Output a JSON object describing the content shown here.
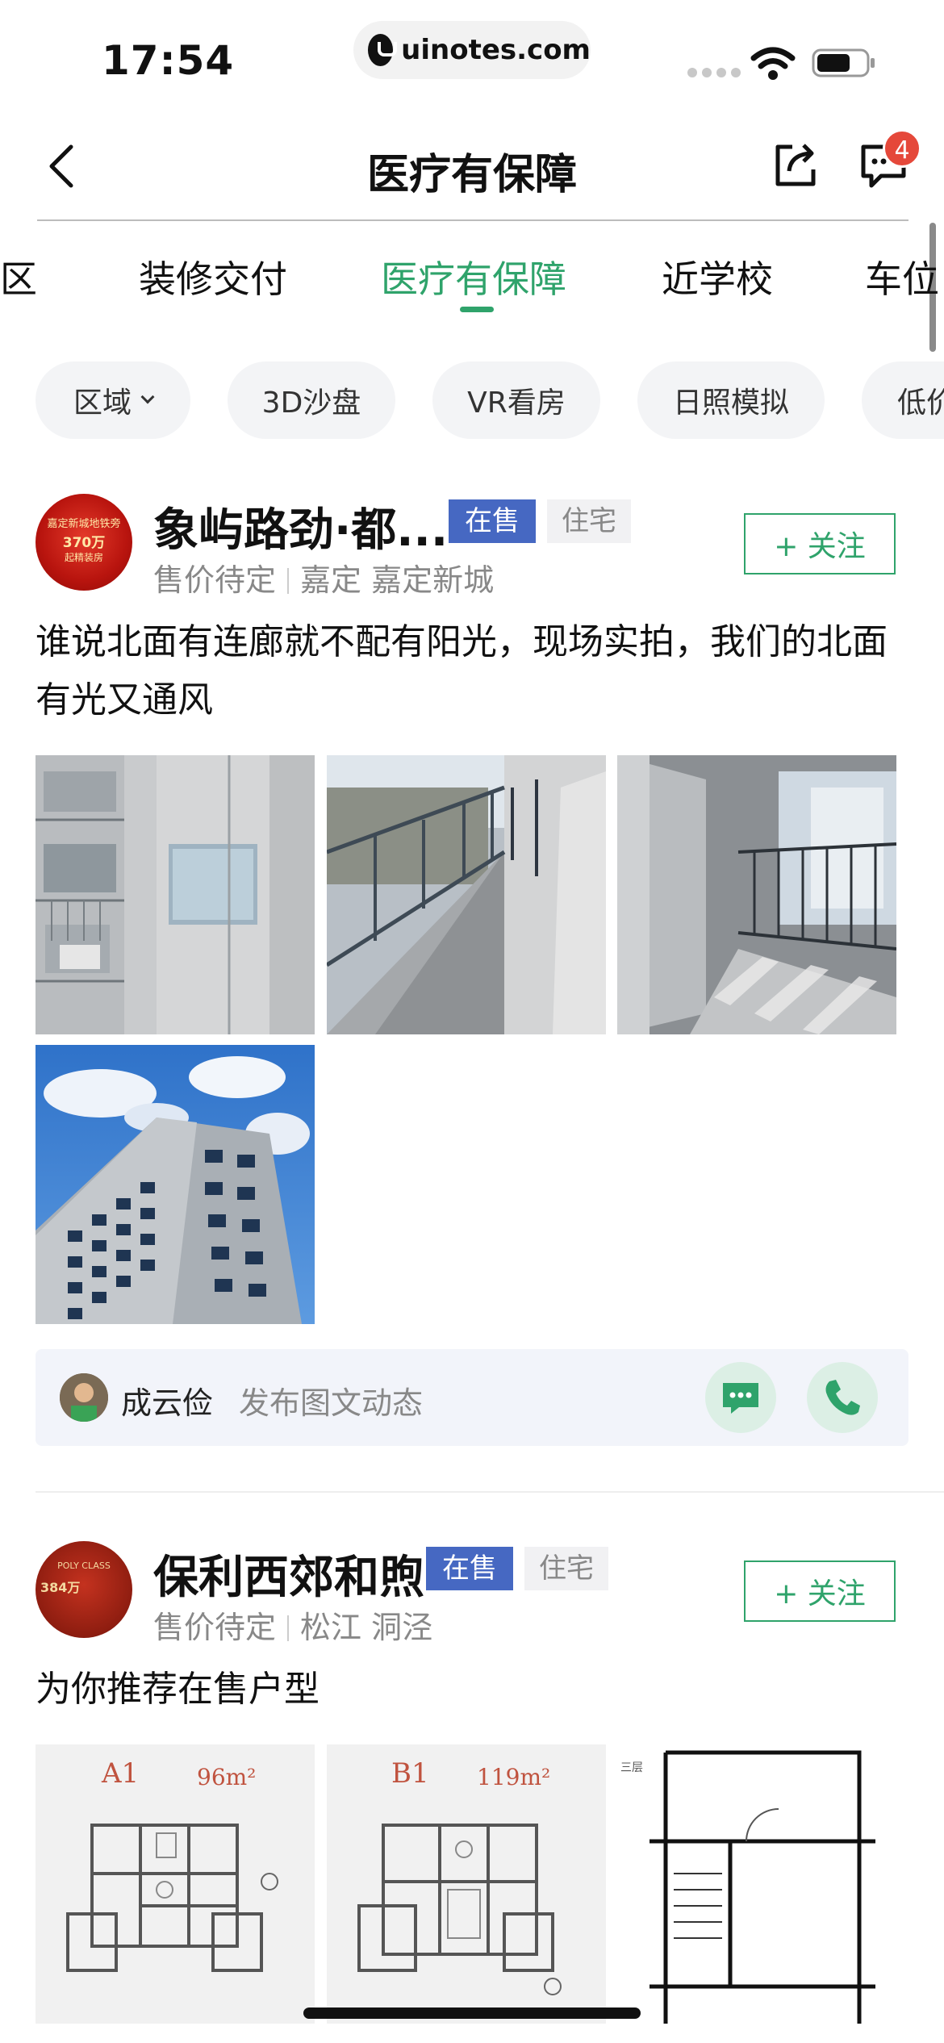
{
  "status_bar": {
    "time": "17:54",
    "url": "uinotes.com"
  },
  "nav": {
    "title": "医疗有保障",
    "message_badge": "4"
  },
  "tabs": [
    {
      "label": "社区",
      "active": false
    },
    {
      "label": "装修交付",
      "active": false
    },
    {
      "label": "医疗有保障",
      "active": true
    },
    {
      "label": "近学校",
      "active": false
    },
    {
      "label": "车位",
      "active": false
    }
  ],
  "chips": [
    "区域",
    "3D沙盘",
    "VR看房",
    "日照模拟",
    "低价"
  ],
  "colors": {
    "accent": "#2fa36b",
    "onsale_tag": "#4668c2",
    "badge": "#e5483a"
  },
  "cards": [
    {
      "avatar_text_1": "嘉定新城地铁旁",
      "avatar_text_2": "370万",
      "avatar_text_3": "起精装房",
      "title": "象屿路劲·都...",
      "status_tag": "在售",
      "type_tag": "住宅",
      "price": "售价待定",
      "location": "嘉定 嘉定新城",
      "follow": "+ 关注",
      "description": "谁说北面有连廊就不配有阳光，现场实拍，我们的北面有光又通风",
      "agent_name": "成云俭",
      "agent_action": "发布图文动态"
    },
    {
      "avatar_text_1": "POLY CLASS",
      "avatar_text_2": "384万",
      "avatar_text_3": "",
      "title": "保利西郊和煦",
      "status_tag": "在售",
      "type_tag": "住宅",
      "price": "售价待定",
      "location": "松江 洞泾",
      "follow": "+ 关注",
      "description": "为你推荐在售户型",
      "floorplans": [
        {
          "code": "A1",
          "area": "96m²"
        },
        {
          "code": "B1",
          "area": "119m²"
        },
        {
          "code": "三层",
          "area": ""
        }
      ]
    }
  ]
}
